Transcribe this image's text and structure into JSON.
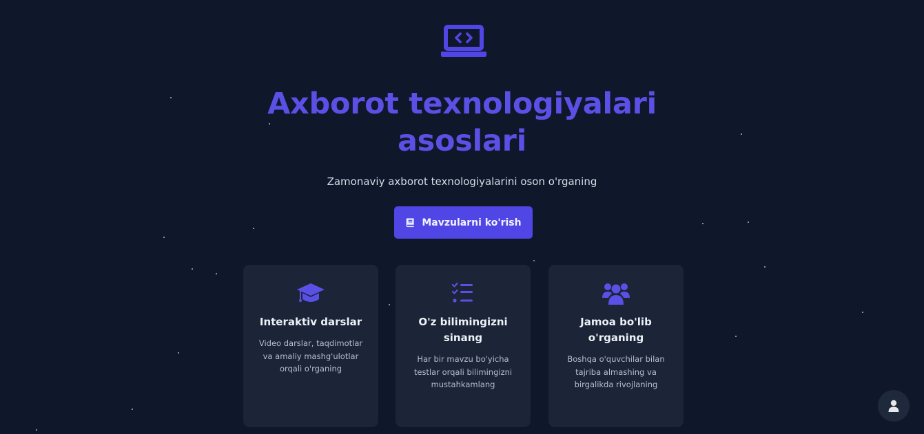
{
  "hero": {
    "icon": "laptop-code-icon",
    "title_line1": "Axborot texnologiyalari",
    "title_line2": "asoslari",
    "subtitle": "Zamonaviy axborot texnologiyalarini oson o'rganing"
  },
  "cta": {
    "icon": "book-icon",
    "label": "Mavzularni ko'rish"
  },
  "features": [
    {
      "icon": "graduation-cap-icon",
      "title": "Interaktiv darslar",
      "description": "Video darslar, taqdimotlar va amaliy mashg'ulotlar orqali o'rganing"
    },
    {
      "icon": "checklist-icon",
      "title": "O'z bilimingizni sinang",
      "description": "Har bir mavzu bo'yicha testlar orqali bilimingizni mustahkamlang"
    },
    {
      "icon": "users-icon",
      "title": "Jamoa bo'lib o'rganing",
      "description": "Boshqa o'quvchilar bilan tajriba almashing va birgalikda rivojlaning"
    }
  ],
  "user_menu": {
    "icon": "user-icon"
  },
  "colors": {
    "background": "#0f172a",
    "accent": "#5046e5",
    "card": "#1b2537"
  }
}
